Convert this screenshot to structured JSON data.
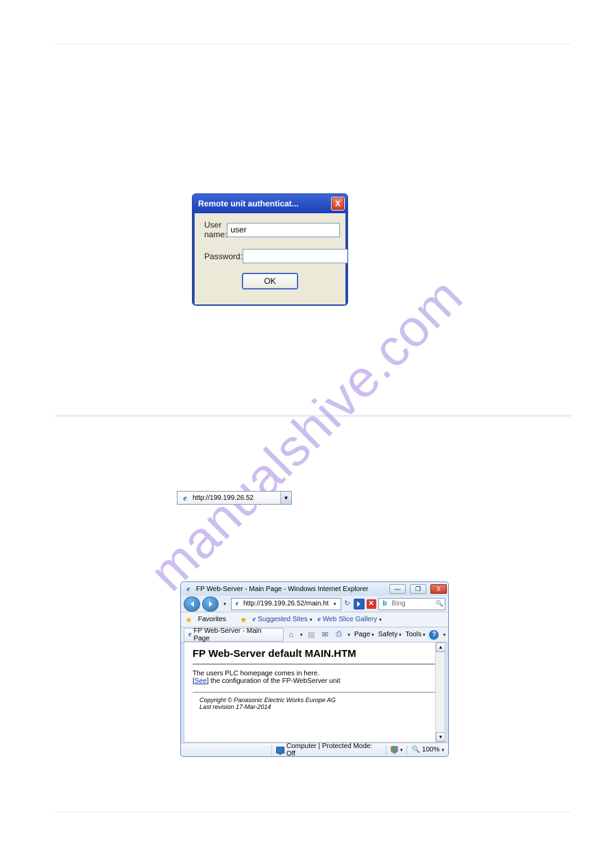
{
  "watermark": "manualshive.com",
  "dialog1": {
    "title": "Remote unit authenticat...",
    "close_glyph": "X",
    "user_label": "User name:",
    "user_value": "user",
    "password_label": "Password:",
    "password_value": "",
    "ok_label": "OK"
  },
  "addressbar_small": {
    "prefix_icon": "e",
    "url": "http://199.199.26.52",
    "dropdown_glyph": "▼"
  },
  "browser": {
    "title": "FP Web-Server - Main Page - Windows Internet Explorer",
    "win_min_glyph": "—",
    "win_max_glyph": "❐",
    "win_close_glyph": "X",
    "nav": {
      "url": "http://199.199.26.52/main.ht",
      "url_dd_glyph": "▾",
      "refresh_glyph": "↻",
      "go_glyph": "→",
      "stop_glyph": "✕",
      "search_engine_glyph": "b",
      "search_placeholder": "Bing",
      "search_mag_glyph": "🔍"
    },
    "favbar": {
      "star_glyph": "★",
      "favorites_label": "Favorites",
      "addstar_glyph": "★",
      "suggested_label": "Suggested Sites",
      "webslice_label": "Web Slice Gallery",
      "dd_glyph": "▾"
    },
    "tabrow": {
      "tab_title": "FP Web-Server - Main Page",
      "home_glyph": "⌂",
      "feed_glyph": "▤",
      "mail_glyph": "✉",
      "print_glyph": "⎙",
      "page_label": "Page",
      "safety_label": "Safety",
      "tools_label": "Tools",
      "help_glyph": "?",
      "dd_glyph": "▾"
    },
    "content": {
      "heading": "FP Web-Server default MAIN.HTM",
      "line1": "The users PLC homepage comes in here.",
      "see_bracket_open": "[",
      "see_text": "See",
      "see_bracket_close": "]",
      "line2_rest": " the configuration of the FP-WebServer unit",
      "footer1": "Copyright © Panasonic Electric Works Europe AG",
      "footer2": "Last revision 17-Mar-2014",
      "scroll_up_glyph": "▲",
      "scroll_down_glyph": "▼"
    },
    "status": {
      "zone_text": "Computer | Protected Mode: Off",
      "zoom_text": "100%",
      "shield_dd": "▾",
      "zoom_glyph": "🔍",
      "zoom_dd": "▾"
    }
  }
}
